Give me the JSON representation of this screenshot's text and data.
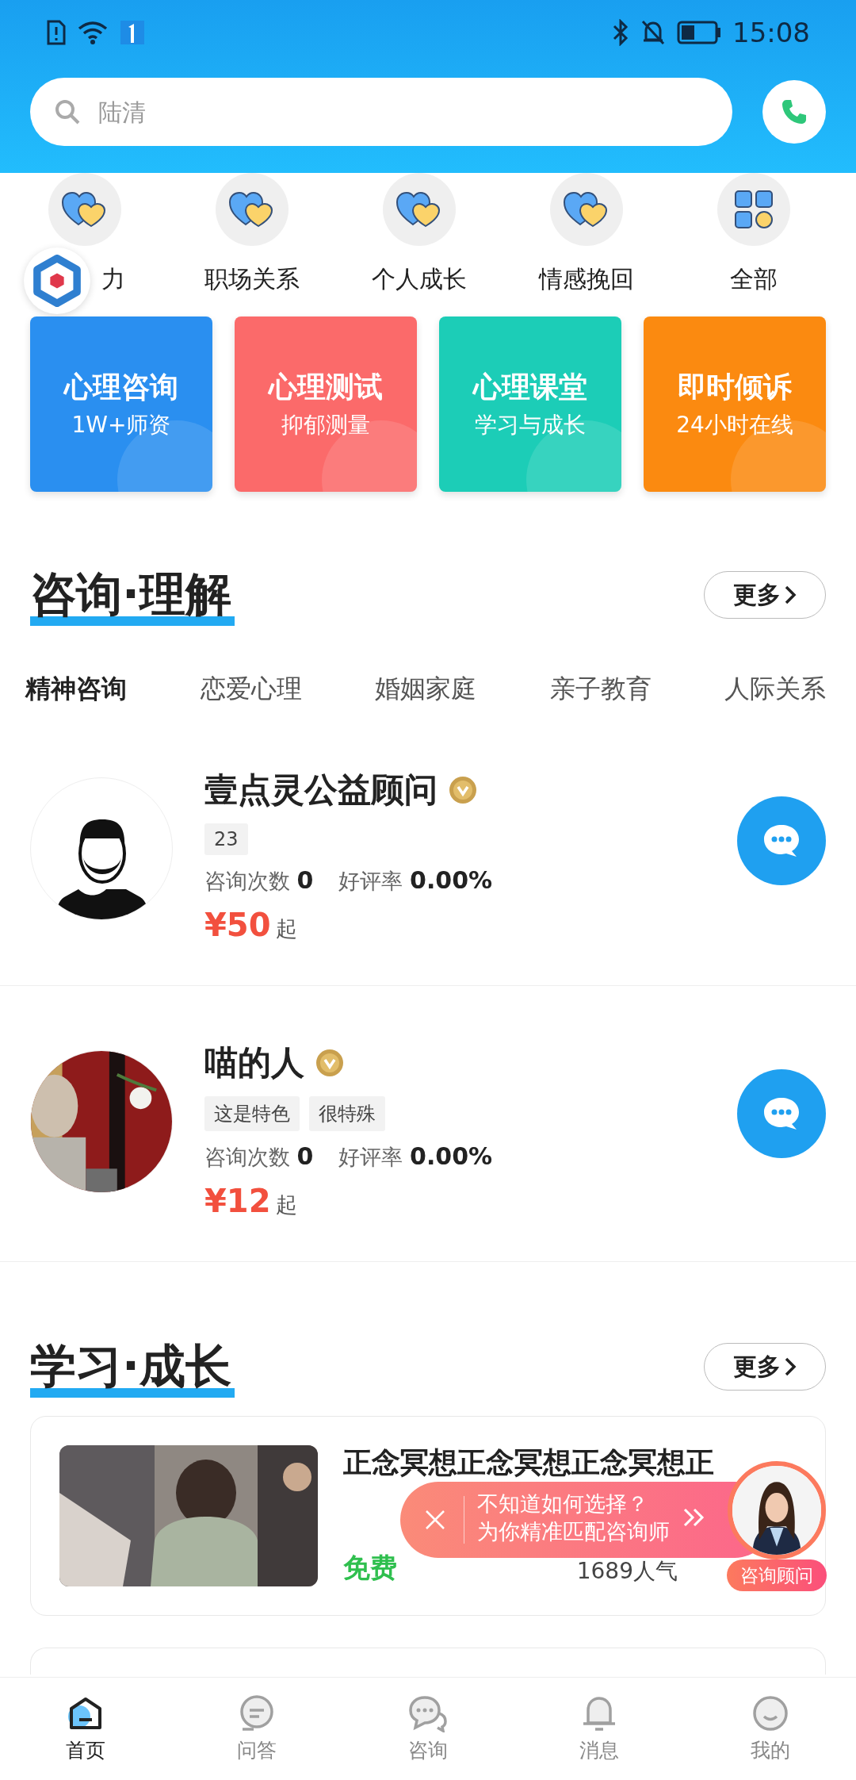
{
  "status_bar": {
    "time": "15:08"
  },
  "search": {
    "placeholder": "陆清"
  },
  "categories": [
    {
      "label": "力",
      "kind": "heart"
    },
    {
      "label": "职场关系",
      "kind": "heart"
    },
    {
      "label": "个人成长",
      "kind": "heart"
    },
    {
      "label": "情感挽回",
      "kind": "heart"
    },
    {
      "label": "全部",
      "kind": "grid"
    }
  ],
  "feature_cards": [
    {
      "title": "心理咨询",
      "subtitle": "1W+师资",
      "color": "#2a8ff0"
    },
    {
      "title": "心理测试",
      "subtitle": "抑郁测量",
      "color": "#fb6a6a"
    },
    {
      "title": "心理课堂",
      "subtitle": "学习与成长",
      "color": "#1ccdb7"
    },
    {
      "title": "即时倾诉",
      "subtitle": "24小时在线",
      "color": "#fb8a10"
    }
  ],
  "consult": {
    "title": "咨询·理解",
    "more": "更多",
    "tabs": [
      {
        "label": "精神咨询",
        "selected": true
      },
      {
        "label": "恋爱心理",
        "selected": false
      },
      {
        "label": "婚姻家庭",
        "selected": false
      },
      {
        "label": "亲子教育",
        "selected": false
      },
      {
        "label": "人际关系",
        "selected": false
      }
    ],
    "counselors": [
      {
        "name": "壹点灵公益顾问",
        "verified": true,
        "kind": "illustration",
        "tags": [
          "23"
        ],
        "count_label": "咨询次数",
        "count": "0",
        "rating_label": "好评率",
        "rating": "0.00%",
        "price": "¥50",
        "price_suffix": "起"
      },
      {
        "name": "喵的人",
        "verified": true,
        "kind": "picture",
        "tags": [
          "这是特色",
          "很特殊"
        ],
        "count_label": "咨询次数",
        "count": "0",
        "rating_label": "好评率",
        "rating": "0.00%",
        "price": "¥12",
        "price_suffix": "起"
      }
    ]
  },
  "learning": {
    "title": "学习·成长",
    "more": "更多",
    "courses": [
      {
        "title": "正念冥想正念冥想正念冥想正",
        "price": "免费",
        "views": "1689人气"
      }
    ]
  },
  "popup": {
    "line1": "不知道如何选择？",
    "line2": "为你精准匹配咨询师",
    "badge": "咨询顾问"
  },
  "bottom_nav": [
    {
      "label": "首页",
      "kind": "home",
      "selected": true
    },
    {
      "label": "问答",
      "kind": "qa",
      "selected": false
    },
    {
      "label": "咨询",
      "kind": "chat",
      "selected": false
    },
    {
      "label": "消息",
      "kind": "bell",
      "selected": false
    },
    {
      "label": "我的",
      "kind": "smile",
      "selected": false
    }
  ]
}
